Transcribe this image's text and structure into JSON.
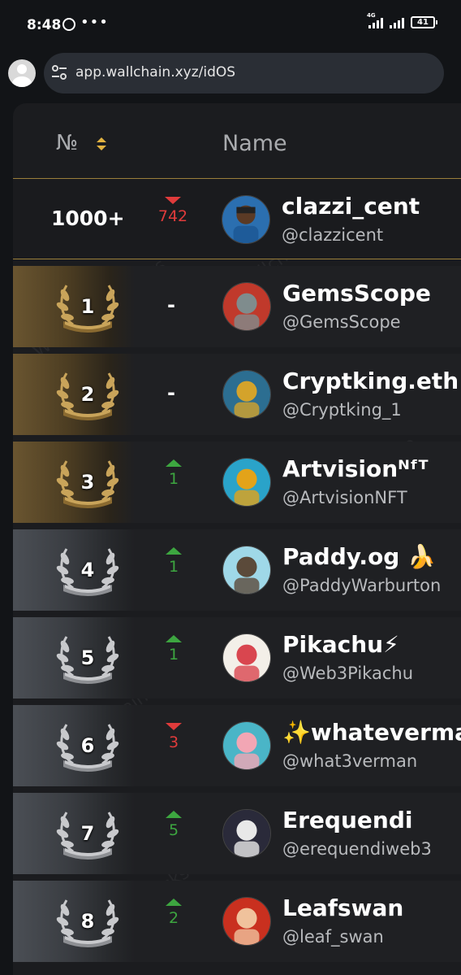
{
  "status_bar": {
    "time": "8:48",
    "signal_tag": "4G",
    "battery": "41",
    "dots": "•••"
  },
  "browser": {
    "url": "app.wallchain.xyz/idOS"
  },
  "table": {
    "col_rank": "№",
    "col_name": "Name"
  },
  "current_user": {
    "rank": "1000+",
    "change_dir": "down",
    "change": "742",
    "name": "clazzi_cent",
    "handle": "@clazzicent"
  },
  "rows": [
    {
      "rank": "1",
      "tier": "gold",
      "change_dir": "none",
      "change": "-",
      "name": "GemsScope",
      "handle": "@GemsScope"
    },
    {
      "rank": "2",
      "tier": "gold",
      "change_dir": "none",
      "change": "-",
      "name": "Cryptking.eth 🔱",
      "handle": "@Cryptking_1"
    },
    {
      "rank": "3",
      "tier": "gold",
      "change_dir": "up",
      "change": "1",
      "name": "Artvisionᴺᶠᵀ",
      "handle": "@ArtvisionNFT"
    },
    {
      "rank": "4",
      "tier": "silver",
      "change_dir": "up",
      "change": "1",
      "name": "Paddy.og 🍌",
      "handle": "@PaddyWarburton"
    },
    {
      "rank": "5",
      "tier": "silver",
      "change_dir": "up",
      "change": "1",
      "name": "Pikachu⚡",
      "handle": "@Web3Pikachu"
    },
    {
      "rank": "6",
      "tier": "silver",
      "change_dir": "down",
      "change": "3",
      "name": "✨whateverman",
      "handle": "@what3verman"
    },
    {
      "rank": "7",
      "tier": "silver",
      "change_dir": "up",
      "change": "5",
      "name": "Erequendi",
      "handle": "@erequendiweb3"
    },
    {
      "rank": "8",
      "tier": "silver",
      "change_dir": "up",
      "change": "2",
      "name": "Leafswan",
      "handle": "@leaf_swan"
    }
  ],
  "colors": {
    "gold": "#c9a45a",
    "silver": "#c8c9cc",
    "up": "#3da640",
    "down": "#e03b3b",
    "accent_border": "#9b7f3b"
  }
}
